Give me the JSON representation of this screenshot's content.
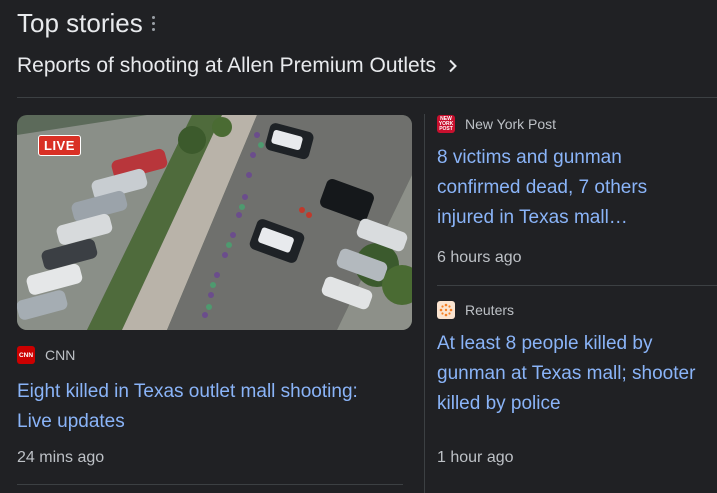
{
  "header": {
    "title": "Top stories",
    "more_icon": "vertical-dots-icon"
  },
  "topic": {
    "label": "Reports of shooting at Allen Premium Outlets",
    "icon": "chevron-right-icon"
  },
  "main_story": {
    "badge": "LIVE",
    "source": "CNN",
    "source_logo_text": "CNN",
    "headline": "Eight killed in Texas outlet mall shooting: Live updates",
    "time": "24 mins ago"
  },
  "side_stories": [
    {
      "source": "New York Post",
      "source_logo_text": "NEW YORK POST",
      "headline": "8 victims and gunman confirmed dead, 7 others injured in Texas mall…",
      "time": "6 hours ago"
    },
    {
      "source": "Reuters",
      "headline": "At least 8 people killed by gunman at Texas mall; shooter killed by police",
      "time": "1 hour ago"
    }
  ],
  "colors": {
    "background": "#202124",
    "link": "#8ab4f8",
    "live": "#d93025"
  }
}
